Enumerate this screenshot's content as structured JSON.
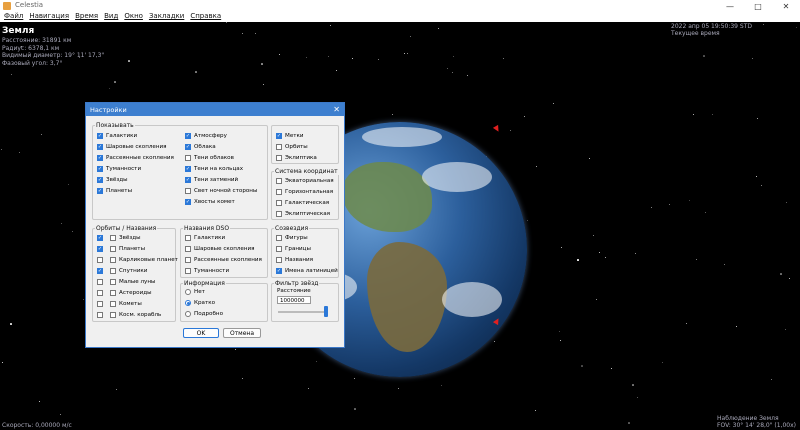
{
  "window": {
    "title": "Celestia",
    "controls": [
      "—",
      "□",
      "✕"
    ]
  },
  "menu": [
    "Файл",
    "Навигация",
    "Время",
    "Вид",
    "Окно",
    "Закладки",
    "Справка"
  ],
  "overlay": {
    "object_name": "Земля",
    "distance": "Расстояние: 31891 км",
    "radius": "Радиус: 6378,1 км",
    "apparent_diameter": "Видимый диаметр: 19° 11' 17,3\"",
    "phase_angle": "Фазовый угол: 3,7°",
    "datetime": "2022 апр 05 19:50:39 STD",
    "time_mode": "Текущее время",
    "speed": "Скорость: 0,00000 м/с",
    "observe": "Наблюдение Земля",
    "fov": "FOV: 30° 14' 28,0\" (1,00x)"
  },
  "dialog": {
    "title": "Настройки",
    "close_icon": "close-icon",
    "show": {
      "label": "Показывать",
      "col1": [
        {
          "label": "Галактики",
          "checked": true
        },
        {
          "label": "Шаровые скопления",
          "checked": true
        },
        {
          "label": "Рассеянные скопления",
          "checked": true
        },
        {
          "label": "Туманности",
          "checked": true
        },
        {
          "label": "Звёзды",
          "checked": true
        },
        {
          "label": "Планеты",
          "checked": true
        }
      ],
      "col2": [
        {
          "label": "Атмосферу",
          "checked": true
        },
        {
          "label": "Облака",
          "checked": true
        },
        {
          "label": "Тени облаков",
          "checked": false
        },
        {
          "label": "Тени на кольцах",
          "checked": true
        },
        {
          "label": "Тени затмений",
          "checked": true
        },
        {
          "label": "Свет ночной стороны",
          "checked": false
        },
        {
          "label": "Хвосты комет",
          "checked": true
        }
      ]
    },
    "labels_group": [
      {
        "label": "Метки",
        "checked": true
      },
      {
        "label": "Орбиты",
        "checked": false
      },
      {
        "label": "Эклиптика",
        "checked": false
      }
    ],
    "coords": {
      "label": "Система координат",
      "items": [
        {
          "label": "Экваториальная",
          "checked": false
        },
        {
          "label": "Горизонтальная",
          "checked": false
        },
        {
          "label": "Галактическая",
          "checked": false
        },
        {
          "label": "Эклиптическая",
          "checked": false
        }
      ]
    },
    "orbits": {
      "label": "Орбиты / Названия",
      "items": [
        {
          "label": "Звёзды",
          "orbit": true,
          "name": false
        },
        {
          "label": "Планеты",
          "orbit": true,
          "name": false
        },
        {
          "label": "Карликовые планет",
          "orbit": false,
          "name": false
        },
        {
          "label": "Спутники",
          "orbit": true,
          "name": false
        },
        {
          "label": "Малые луны",
          "orbit": false,
          "name": false
        },
        {
          "label": "Астероиды",
          "orbit": false,
          "name": false
        },
        {
          "label": "Кометы",
          "orbit": false,
          "name": false
        },
        {
          "label": "Косм. корабль",
          "orbit": false,
          "name": false
        }
      ]
    },
    "dso": {
      "label": "Названия DSO",
      "items": [
        {
          "label": "Галактики",
          "checked": false
        },
        {
          "label": "Шаровые скопления",
          "checked": false
        },
        {
          "label": "Рассеянные скопления",
          "checked": false
        },
        {
          "label": "Туманности",
          "checked": false
        }
      ]
    },
    "constellations": {
      "label": "Созвездия",
      "items": [
        {
          "label": "Фигуры",
          "checked": false
        },
        {
          "label": "Границы",
          "checked": false
        },
        {
          "label": "Названия",
          "checked": false
        },
        {
          "label": "Имена латиницей",
          "checked": true
        }
      ]
    },
    "info": {
      "label": "Информация",
      "items": [
        {
          "label": "Нет",
          "selected": false
        },
        {
          "label": "Кратко",
          "selected": true
        },
        {
          "label": "Подробно",
          "selected": false
        }
      ]
    },
    "star_filter": {
      "label": "Фильтр звёзд",
      "distance_label": "Расстояние",
      "distance_value": "1000000",
      "slider_fraction": 1.0
    },
    "ok": "OK",
    "cancel": "Отмена"
  }
}
